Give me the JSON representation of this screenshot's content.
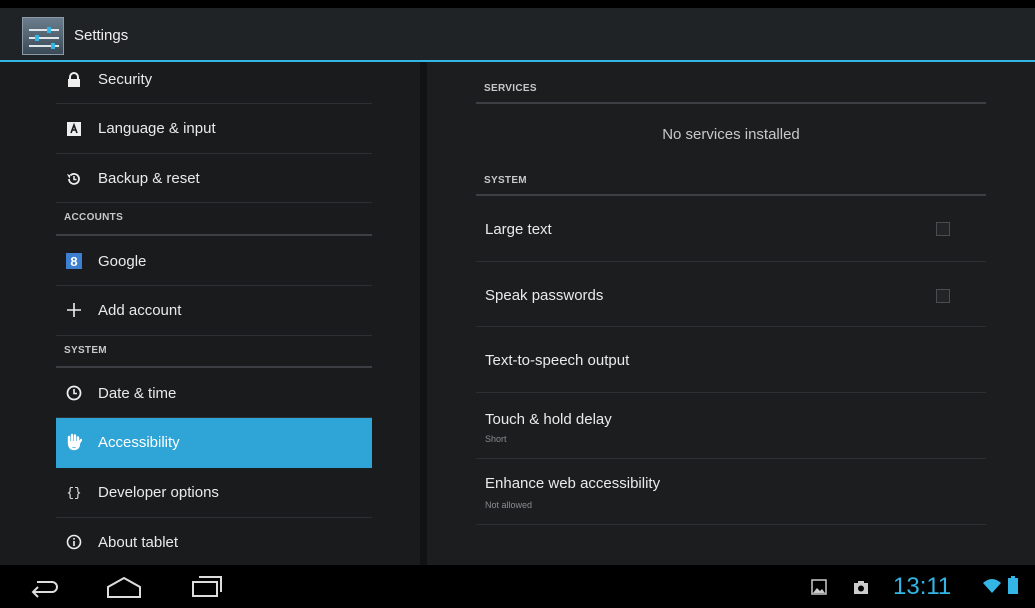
{
  "app": {
    "title": "Settings"
  },
  "colors": {
    "accent": "#33b5e5",
    "selected": "#2fa4d6",
    "background": "#1b1d1f"
  },
  "sidebar": {
    "items_top": [
      {
        "label": "Security",
        "icon": "lock-icon"
      },
      {
        "label": "Language & input",
        "icon": "keyboard-icon"
      },
      {
        "label": "Backup & reset",
        "icon": "restore-icon"
      }
    ],
    "accounts_header": "ACCOUNTS",
    "accounts": [
      {
        "label": "Google",
        "icon": "google-icon"
      },
      {
        "label": "Add account",
        "icon": "plus-icon"
      }
    ],
    "system_header": "SYSTEM",
    "system": [
      {
        "label": "Date & time",
        "icon": "clock-icon"
      },
      {
        "label": "Accessibility",
        "icon": "hand-icon",
        "selected": true
      },
      {
        "label": "Developer options",
        "icon": "braces-icon"
      },
      {
        "label": "About tablet",
        "icon": "info-icon"
      }
    ]
  },
  "detail": {
    "services_header": "SERVICES",
    "services_empty": "No services installed",
    "system_header": "SYSTEM",
    "items": [
      {
        "title": "Large text",
        "checkbox": true,
        "checked": false
      },
      {
        "title": "Speak passwords",
        "checkbox": true,
        "checked": false
      },
      {
        "title": "Text-to-speech output"
      },
      {
        "title": "Touch & hold delay",
        "summary": "Short"
      },
      {
        "title": "Enhance web accessibility",
        "summary": "Not allowed"
      }
    ]
  },
  "navbar": {
    "back": "back-icon",
    "home": "home-icon",
    "recents": "recents-icon"
  },
  "status": {
    "time": "13:11",
    "icons": [
      "gallery-icon",
      "camera-icon",
      "wifi-icon",
      "battery-icon"
    ]
  }
}
